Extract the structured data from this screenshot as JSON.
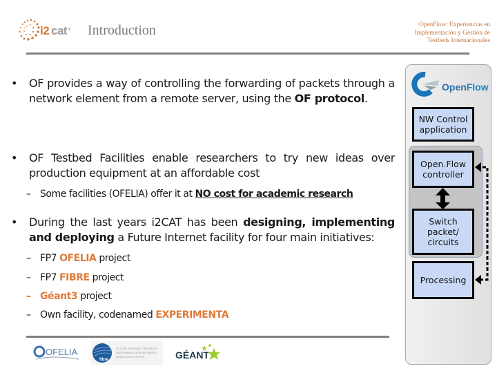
{
  "header": {
    "title": "Introduction",
    "subtitle_lines": [
      "OpenFlow: Experiencias en",
      "Implementación y Gestión de",
      "Testbeds Internacionales"
    ],
    "logo": "i2cat"
  },
  "bullets": [
    {
      "parts": [
        "OF provides a way of controlling the forwarding of packets through a network element from a remote server, using the ",
        "OF protocol",
        "."
      ]
    },
    {
      "parts": [
        "OF Testbed Facilities enable researchers to try new ideas over production equipment at an affordable cost"
      ],
      "sub": [
        {
          "dash": "–",
          "parts": [
            "Some facilities (OFELIA) offer it at ",
            "NO cost for academic research"
          ]
        }
      ]
    },
    {
      "parts": [
        "During the last years i2CAT has been ",
        "designing, implementing and deploying",
        " a Future Internet facility for four main initiatives:"
      ],
      "sub": [
        {
          "dash": "–",
          "parts": [
            "FP7 ",
            "OFELIA",
            " project"
          ]
        },
        {
          "dash": "–",
          "parts": [
            "FP7 ",
            "FIBRE",
            " project"
          ]
        },
        {
          "dash": "–",
          "parts": [
            "",
            "Géant3",
            " project"
          ]
        },
        {
          "dash": "–",
          "parts": [
            "Own facility, codenamed ",
            "EXPERIMENTA"
          ]
        }
      ]
    }
  ],
  "bullet_glyph": "•",
  "diagram": {
    "logo_text_a": "Open",
    "logo_text_b": "Flow",
    "boxes": [
      {
        "label_lines": [
          "NW Control",
          "application"
        ]
      },
      {
        "label_lines": [
          "Open.Flow",
          "controller"
        ]
      },
      {
        "label_lines": [
          "Switch",
          "packet/",
          "circuits"
        ]
      },
      {
        "label_lines": [
          "Processing"
        ]
      }
    ]
  },
  "footer": {
    "logos": [
      "OFELIA",
      "fibre",
      "GÉANT"
    ],
    "fibre_caption": [
      "FUTURE INTERNET TESTBEDS",
      "EXPERIMENTATION BETWEEN",
      "BRAZIL AND EUROPE"
    ]
  },
  "colors": {
    "accent_orange": "#e07b39",
    "subtitle_orange": "#c77c45",
    "box_blue": "#c9d9f5",
    "openflow_blue": "#1d86c6"
  }
}
